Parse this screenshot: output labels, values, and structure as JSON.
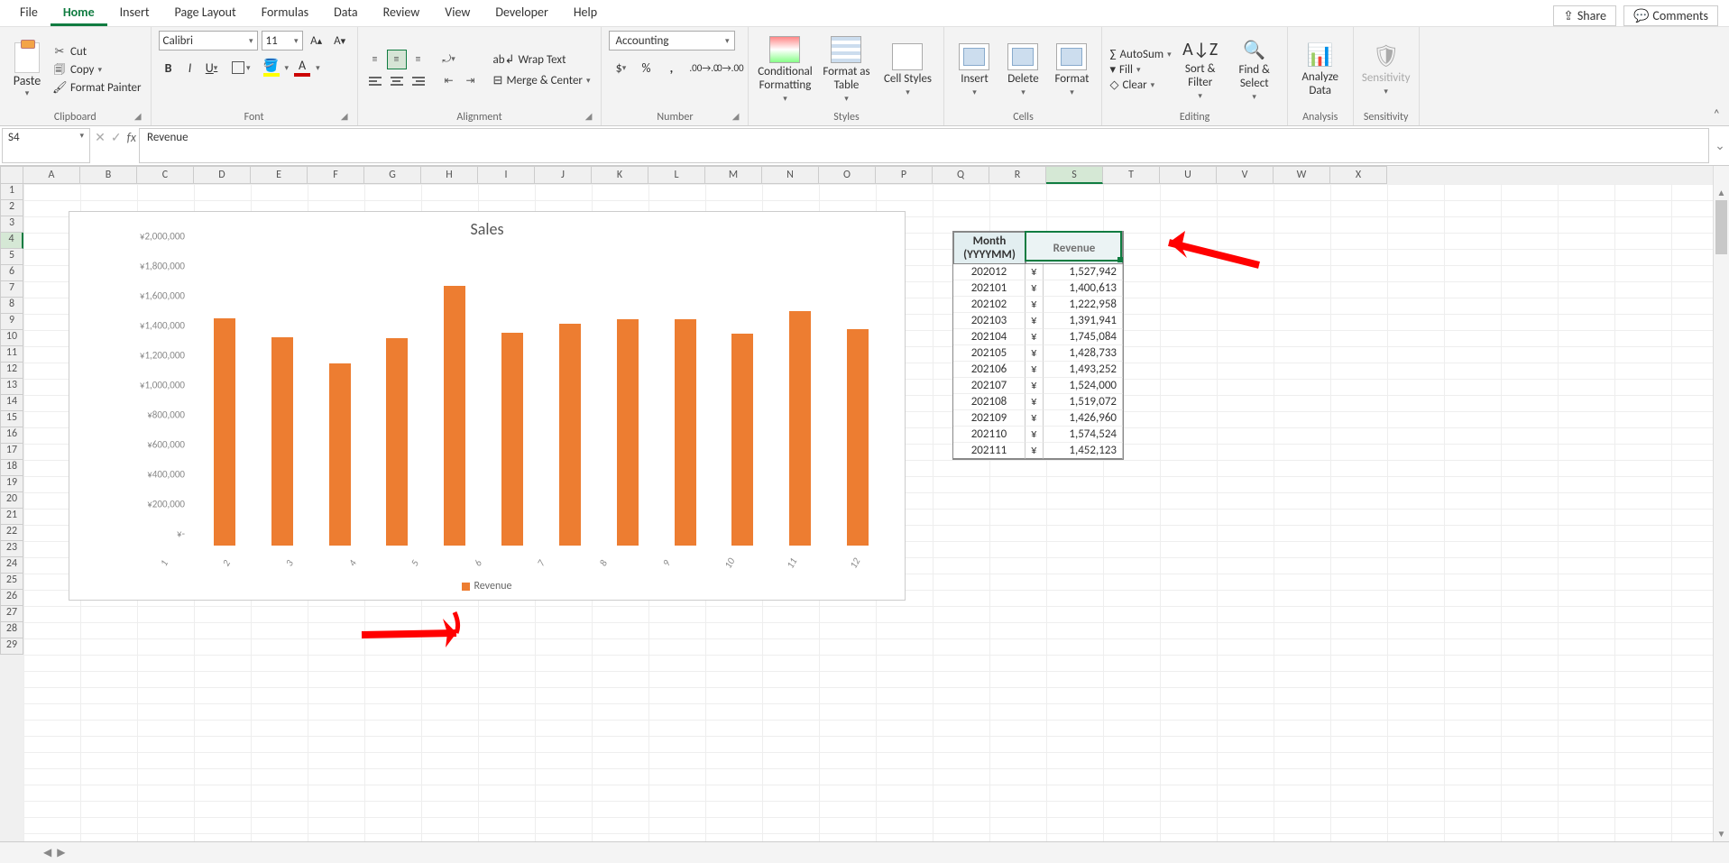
{
  "tabs": {
    "items": [
      "File",
      "Home",
      "Insert",
      "Page Layout",
      "Formulas",
      "Data",
      "Review",
      "View",
      "Developer",
      "Help"
    ],
    "active": "Home",
    "share": "Share",
    "comments": "Comments"
  },
  "ribbon": {
    "clipboard": {
      "label": "Clipboard",
      "paste": "Paste",
      "cut": "Cut",
      "copy": "Copy",
      "format_painter": "Format Painter"
    },
    "font": {
      "label": "Font",
      "name": "Calibri",
      "size": "11",
      "incr_a": "A",
      "decr_a": "A"
    },
    "alignment": {
      "label": "Alignment",
      "wrap": "Wrap Text",
      "merge": "Merge & Center"
    },
    "number": {
      "label": "Number",
      "format": "Accounting"
    },
    "styles": {
      "label": "Styles",
      "cond": "Conditional Formatting",
      "fas": "Format as Table",
      "cell": "Cell Styles"
    },
    "cells": {
      "label": "Cells",
      "insert": "Insert",
      "delete": "Delete",
      "format": "Format"
    },
    "editing": {
      "label": "Editing",
      "autosum": "AutoSum",
      "fill": "Fill",
      "clear": "Clear",
      "sort": "Sort & Filter",
      "find": "Find & Select"
    },
    "analysis": {
      "label": "Analysis",
      "analyze": "Analyze Data"
    },
    "sensitivity": {
      "label": "Sensitivity",
      "sens": "Sensitivity"
    }
  },
  "formula_bar": {
    "name_box": "S4",
    "formula": "Revenue"
  },
  "columns": [
    "A",
    "B",
    "C",
    "D",
    "E",
    "F",
    "G",
    "H",
    "I",
    "J",
    "K",
    "L",
    "M",
    "N",
    "O",
    "P",
    "Q",
    "R",
    "S",
    "T",
    "U",
    "V",
    "W",
    "X"
  ],
  "selected_col": "S",
  "row_count": 29,
  "selected_row": 4,
  "chart_data": {
    "type": "bar",
    "title": "Sales",
    "categories": [
      "1",
      "2",
      "3",
      "4",
      "5",
      "6",
      "7",
      "8",
      "9",
      "10",
      "11",
      "12"
    ],
    "series": [
      {
        "name": "Revenue",
        "values": [
          1527942,
          1400613,
          1222958,
          1391941,
          1745084,
          1428733,
          1493252,
          1524000,
          1519072,
          1426960,
          1574524,
          1452123
        ]
      }
    ],
    "ylim": [
      0,
      2000000
    ],
    "yticks_labels": [
      "¥-",
      "¥200,000",
      "¥400,000",
      "¥600,000",
      "¥800,000",
      "¥1,000,000",
      "¥1,200,000",
      "¥1,400,000",
      "¥1,600,000",
      "¥1,800,000",
      "¥2,000,000"
    ],
    "yticks_values": [
      0,
      200000,
      400000,
      600000,
      800000,
      1000000,
      1200000,
      1400000,
      1600000,
      1800000,
      2000000
    ],
    "legend": "Revenue"
  },
  "table": {
    "headers": {
      "month": "Month (YYYYMM)",
      "revenue": "Revenue"
    },
    "currency": "¥",
    "rows": [
      {
        "month": "202012",
        "revenue": "1,527,942"
      },
      {
        "month": "202101",
        "revenue": "1,400,613"
      },
      {
        "month": "202102",
        "revenue": "1,222,958"
      },
      {
        "month": "202103",
        "revenue": "1,391,941"
      },
      {
        "month": "202104",
        "revenue": "1,745,084"
      },
      {
        "month": "202105",
        "revenue": "1,428,733"
      },
      {
        "month": "202106",
        "revenue": "1,493,252"
      },
      {
        "month": "202107",
        "revenue": "1,524,000"
      },
      {
        "month": "202108",
        "revenue": "1,519,072"
      },
      {
        "month": "202109",
        "revenue": "1,426,960"
      },
      {
        "month": "202110",
        "revenue": "1,574,524"
      },
      {
        "month": "202111",
        "revenue": "1,452,123"
      }
    ]
  },
  "symbols": {
    "dollar": "$",
    "percent": "%",
    "comma": ",",
    "sigma": "∑",
    "funnel": "▼",
    "magnifier": "🔍"
  }
}
